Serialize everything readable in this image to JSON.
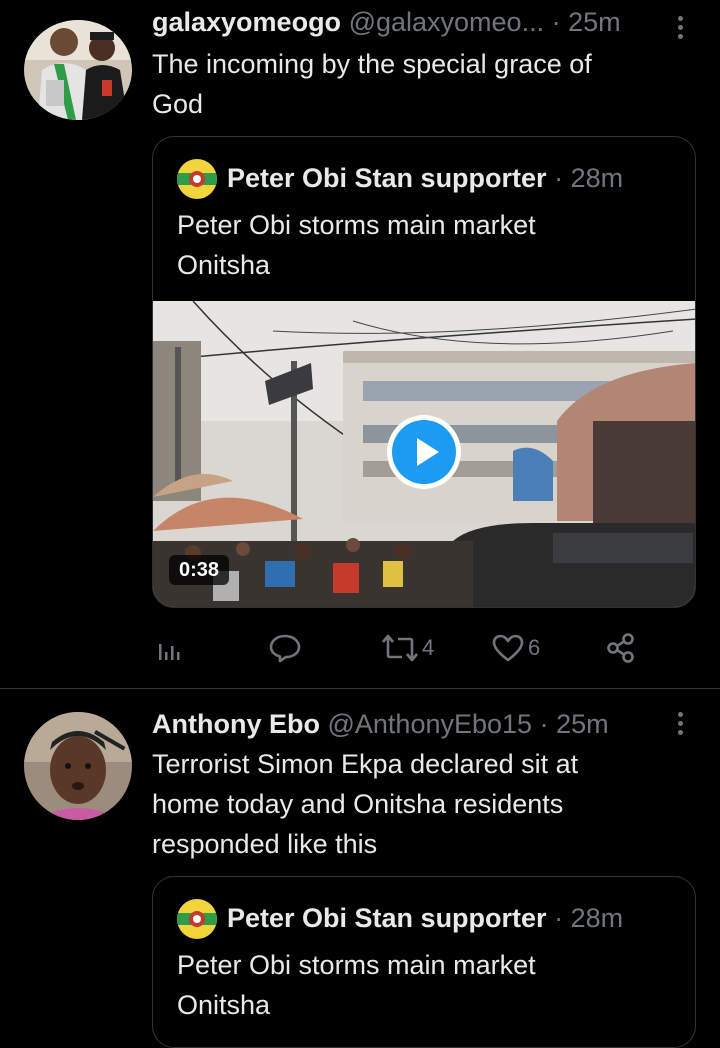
{
  "tweets": [
    {
      "author_name": "galaxyomeogo",
      "handle": "@galaxyomeo...",
      "time": "25m",
      "text_lines": [
        "The incoming by the special grace of",
        "God"
      ],
      "quote": {
        "author_name": "Peter Obi Stan supporter",
        "time": "28m",
        "text_lines": [
          "Peter Obi storms main market",
          "Onitsha"
        ],
        "video_duration": "0:38"
      },
      "actions": {
        "retweets": "4",
        "likes": "6"
      }
    },
    {
      "author_name": "Anthony Ebo",
      "handle": "@AnthonyEbo15",
      "time": "25m",
      "text_lines": [
        "Terrorist Simon Ekpa declared sit at",
        "home today and Onitsha residents",
        "responded like this"
      ],
      "quote": {
        "author_name": "Peter Obi Stan supporter",
        "time": "28m",
        "text_lines": [
          "Peter Obi storms main market",
          "Onitsha"
        ]
      }
    }
  ],
  "separator": "·",
  "icons": {
    "analytics": "analytics-icon",
    "reply": "reply-icon",
    "retweet": "retweet-icon",
    "like": "like-icon",
    "share": "share-icon",
    "more": "more-vertical-icon",
    "play": "play-icon"
  },
  "colors": {
    "background": "#000000",
    "text": "#e7e9ea",
    "muted": "#71767b",
    "border": "#2f3336",
    "accent": "#1d9bf0"
  }
}
